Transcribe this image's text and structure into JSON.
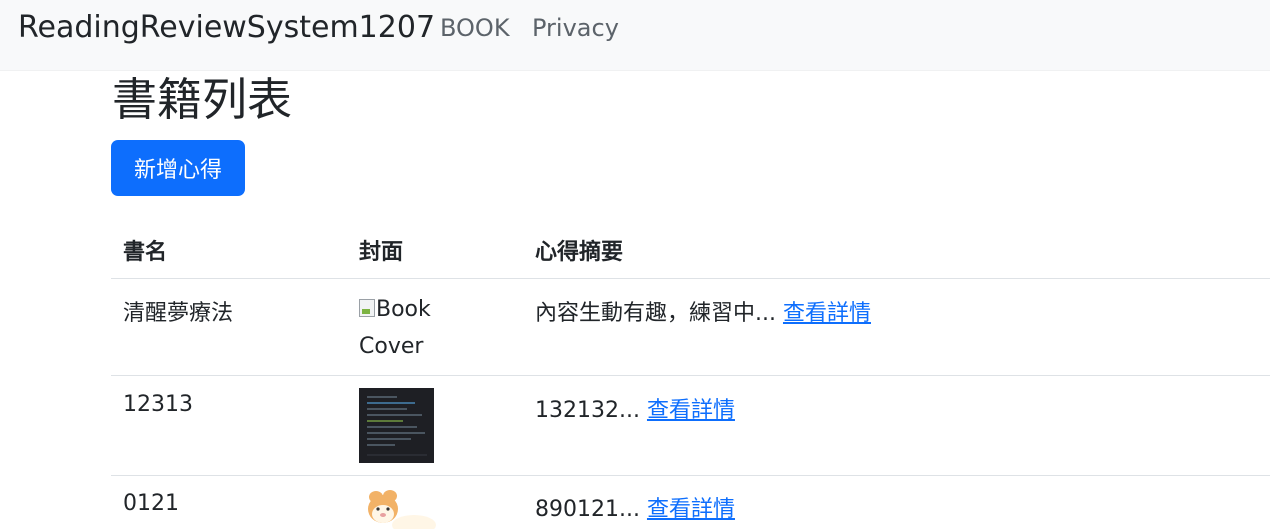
{
  "navbar": {
    "brand": "ReadingReviewSystem1207",
    "links": [
      "BOOK",
      "Privacy"
    ]
  },
  "page": {
    "title": "書籍列表",
    "add_button": "新增心得"
  },
  "table": {
    "headers": [
      "書名",
      "封面",
      "心得摘要"
    ],
    "rows": [
      {
        "title": "清醒夢療法",
        "cover_alt": "Book Cover",
        "summary": "內容生動有趣，練習中...",
        "link": "查看詳情"
      },
      {
        "title": "12313",
        "summary": "132132...",
        "link": "查看詳情"
      },
      {
        "title": "0121",
        "summary": "890121...",
        "link": "查看詳情"
      }
    ]
  },
  "colors": {
    "primary": "#0d6efd",
    "navbar_bg": "#f8f9fa",
    "text": "#212529",
    "nav_text": "#5c636a"
  }
}
